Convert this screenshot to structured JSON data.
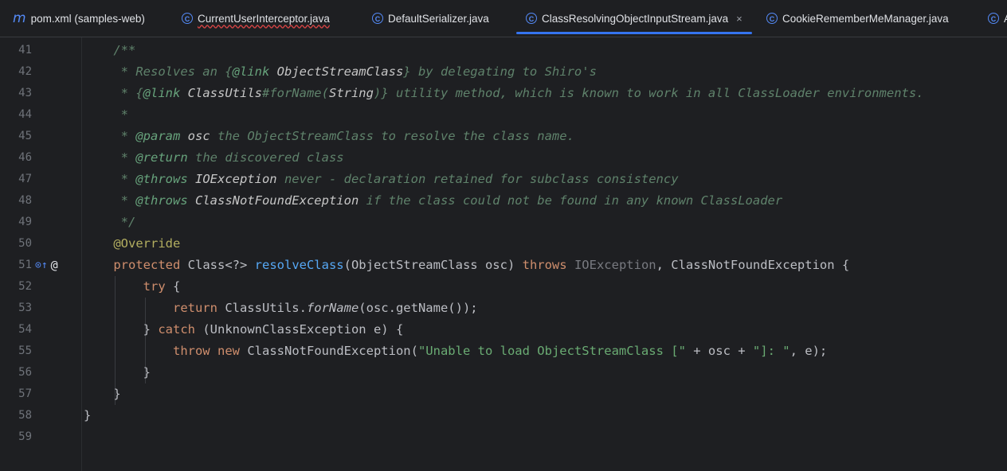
{
  "tabs": [
    {
      "label": "pom.xml (samples-web)",
      "icon": "maven-m-icon",
      "glyph": "m"
    },
    {
      "label": "CurrentUserInterceptor.java",
      "icon": "class-c-icon",
      "glyph": "C"
    },
    {
      "label": "DefaultSerializer.java",
      "icon": "class-c-icon",
      "glyph": "C"
    },
    {
      "label": "ClassResolvingObjectInputStream.java",
      "icon": "class-c-icon",
      "glyph": "C",
      "close": "×"
    },
    {
      "label": "CookieRememberMeManager.java",
      "icon": "class-c-icon",
      "glyph": "C"
    },
    {
      "label": "A",
      "icon": "class-c-icon",
      "glyph": "C"
    }
  ],
  "gutter": {
    "line51_icon1": "⊙↑",
    "line51_icon2": "@"
  },
  "lines": [
    {
      "n": "41",
      "t": "    /**"
    },
    {
      "n": "42",
      "p": [
        "     * Resolves an {",
        "@link",
        " ObjectStreamClass",
        "} by delegating to Shiro's"
      ]
    },
    {
      "n": "43",
      "p": [
        "     * {",
        "@link",
        " ClassUtils",
        "#forName(",
        "String",
        ")}",
        " utility method, which is known to work in all ClassLoader environments."
      ]
    },
    {
      "n": "44",
      "t": "     *"
    },
    {
      "n": "45",
      "p": [
        "     * ",
        "@param",
        " osc",
        " the ObjectStreamClass to resolve the class name."
      ]
    },
    {
      "n": "46",
      "p": [
        "     * ",
        "@return",
        " the discovered class"
      ]
    },
    {
      "n": "47",
      "p": [
        "     * ",
        "@throws",
        " IOException",
        " never - declaration retained for subclass consistency"
      ]
    },
    {
      "n": "48",
      "p": [
        "     * ",
        "@throws",
        " ClassNotFoundException",
        " if the class could not be found in any known ClassLoader"
      ]
    },
    {
      "n": "49",
      "t": "     */"
    },
    {
      "n": "50",
      "p": [
        "    ",
        "@Override"
      ]
    },
    {
      "n": "51",
      "p": [
        "    ",
        "protected",
        " Class<?> ",
        "resolveClass",
        "(ObjectStreamClass osc) ",
        "throws",
        " ",
        "IOException",
        ", ClassNotFoundException {"
      ]
    },
    {
      "n": "52",
      "p": [
        "        ",
        "try",
        " {"
      ]
    },
    {
      "n": "53",
      "p": [
        "            ",
        "return",
        " ClassUtils.",
        "forName",
        "(osc.getName());"
      ]
    },
    {
      "n": "54",
      "p": [
        "        } ",
        "catch",
        " (UnknownClassException e) {"
      ]
    },
    {
      "n": "55",
      "p": [
        "            ",
        "throw",
        " ",
        "new",
        " ClassNotFoundException(",
        "\"Unable to load ObjectStreamClass [\"",
        " + osc + ",
        "\"]: \"",
        ", e);"
      ]
    },
    {
      "n": "56",
      "t": "        }"
    },
    {
      "n": "57",
      "t": "    }"
    },
    {
      "n": "58",
      "t": "}"
    },
    {
      "n": "59",
      "t": ""
    }
  ]
}
